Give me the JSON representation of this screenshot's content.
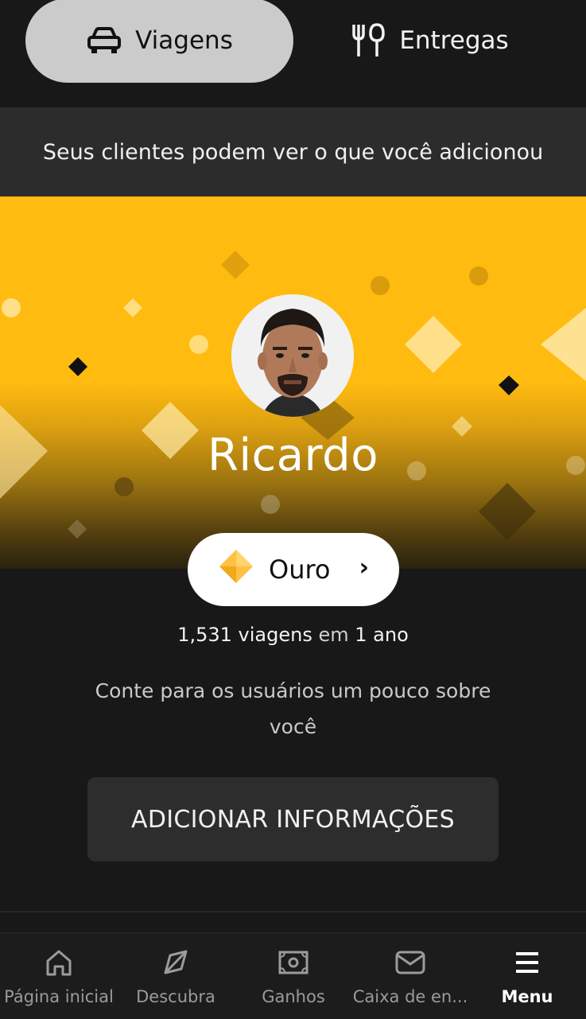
{
  "top_tabs": {
    "viagens_label": "Viagens",
    "entregas_label": "Entregas",
    "selected": "Viagens"
  },
  "info_strip": {
    "text": "Seus clientes podem ver o que você adicionou"
  },
  "profile": {
    "name": "Ricardo",
    "tier_label": "Ouro",
    "tier_color": "#FFC043",
    "banner_color": "#FFBB10",
    "trips_count": "1,531 viagens",
    "trips_conjunction": "em",
    "tenure": "1 ano",
    "bio_prompt": "Conte para os usuários um pouco sobre você",
    "add_info_button": "ADICIONAR INFORMAÇÕES"
  },
  "bottom_nav": {
    "items": [
      {
        "label": "Página inicial",
        "icon": "home-icon",
        "active": false
      },
      {
        "label": "Descubra",
        "icon": "compass-icon",
        "active": false
      },
      {
        "label": "Ganhos",
        "icon": "earnings-icon",
        "active": false
      },
      {
        "label": "Caixa de en...",
        "icon": "mail-icon",
        "active": false
      },
      {
        "label": "Menu",
        "icon": "menu-icon",
        "active": true
      }
    ]
  }
}
